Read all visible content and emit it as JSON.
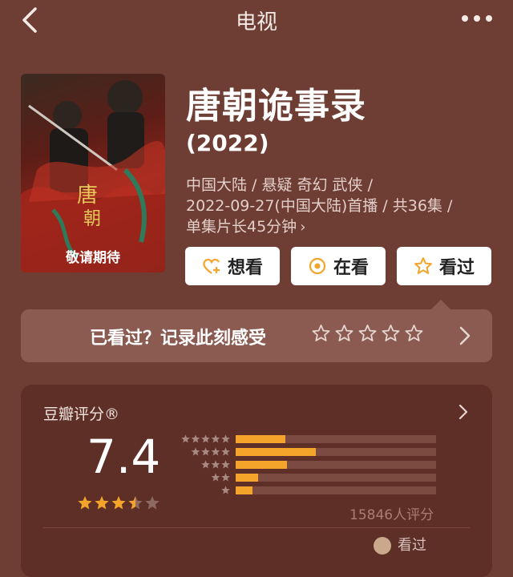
{
  "nav": {
    "title": "电视"
  },
  "poster": {
    "badge": "敬请期待"
  },
  "show": {
    "title": "唐朝诡事录",
    "year": "(2022)",
    "meta_line1": "中国大陆 / 悬疑 奇幻 武侠 /",
    "meta_line2": "2022-09-27(中国大陆)首播 / 共36集 /",
    "meta_line3": "单集片长45分钟",
    "meta_arrow": "›"
  },
  "actions": {
    "want": "想看",
    "watching": "在看",
    "watched": "看过"
  },
  "record": {
    "prompt": "已看过？记录此刻感受"
  },
  "rating": {
    "label": "豆瓣评分®",
    "score": "7.4",
    "score_value": 7.4,
    "stars_filled": 3.5,
    "count": "15846人评分",
    "distribution": [
      {
        "stars": 5,
        "fraction": 0.23
      },
      {
        "stars": 4,
        "fraction": 0.4
      },
      {
        "stars": 3,
        "fraction": 0.24
      },
      {
        "stars": 2,
        "fraction": 0.08
      },
      {
        "stars": 1,
        "fraction": 0.05
      }
    ],
    "watched_partial": "看过"
  },
  "colors": {
    "accent": "#f4a42b",
    "background": "#6e3d33",
    "card": "#5d2f26"
  }
}
